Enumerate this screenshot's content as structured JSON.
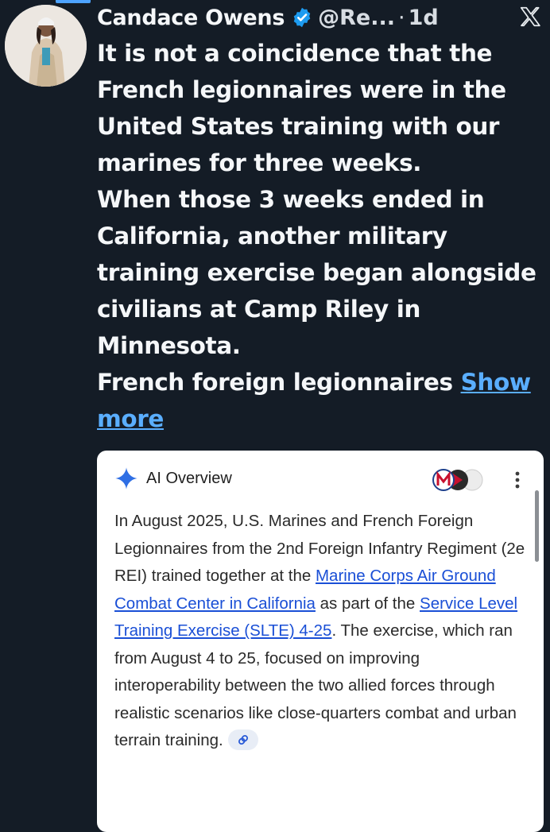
{
  "tweet": {
    "author_name": "Candace Owens",
    "handle": "@Re...",
    "separator": "·",
    "time": "1d",
    "text": "It is not a coincidence that the French legionnaires were in the United States training with our marines for three weeks.\nWhen those 3 weeks ended in California, another military training exercise began alongside civilians at Camp Riley in Minnesota.\nFrench foreign legionnaires ",
    "show_more": "Show more"
  },
  "ai_overview": {
    "title": "AI Overview",
    "p1": "In August 2025, U.S. Marines and French Foreign Legionnaires from the 2nd Foreign Infantry Regiment (2e REI) trained together at the ",
    "link1": "Marine Corps Air Ground Combat Center in California",
    "p2": " as part of the ",
    "link2": "Service Level Training Exercise (SLTE) 4-25",
    "p3": ". The exercise, which ran from August 4 to 25, focused on improving interoperability between the two allied forces through realistic scenarios like close-quarters combat and urban terrain training."
  },
  "colors": {
    "background": "#141c26",
    "link_blue": "#5aaeff",
    "verified_blue": "#1d9bf0",
    "card_link": "#1a4fd6"
  },
  "icons": [
    "verified-icon",
    "x-logo-icon",
    "sparkle-icon",
    "more-vert-icon",
    "link-icon"
  ]
}
